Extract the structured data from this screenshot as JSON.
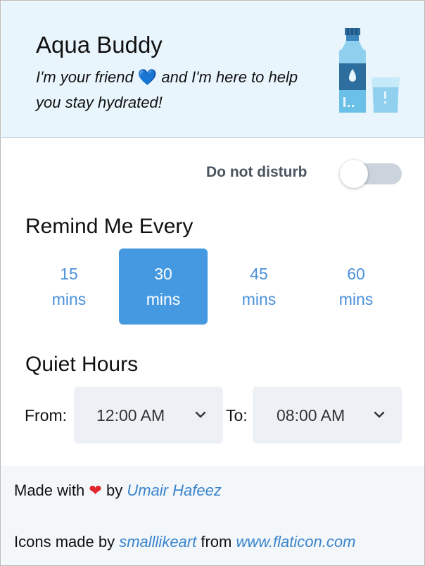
{
  "header": {
    "title": "Aqua Buddy",
    "tagline_before": "I'm your friend",
    "tagline_heart": "💙",
    "tagline_after": "and I'm here to help you stay hydrated!",
    "illustration": "water-bottle-and-glass-icon"
  },
  "dnd": {
    "label": "Do not disturb",
    "enabled": false
  },
  "reminder": {
    "title": "Remind Me Every",
    "options": [
      {
        "value": "15",
        "unit": "mins",
        "selected": false
      },
      {
        "value": "30",
        "unit": "mins",
        "selected": true
      },
      {
        "value": "45",
        "unit": "mins",
        "selected": false
      },
      {
        "value": "60",
        "unit": "mins",
        "selected": false
      }
    ]
  },
  "quiet_hours": {
    "title": "Quiet Hours",
    "from_label": "From:",
    "from_value": "12:00 AM",
    "to_label": "To:",
    "to_value": "08:00 AM"
  },
  "footer": {
    "made_with": "Made with",
    "heart": "❤",
    "by": "by",
    "author": "Umair Hafeez",
    "icons_made_by": "Icons made by",
    "icon_author": "smalllikeart",
    "from": "from",
    "icon_site": "www.flaticon.com"
  },
  "colors": {
    "accent": "#4599e0",
    "link": "#3a84cc",
    "header_bg": "#e9f5fc",
    "toggle_off": "#cbd3dc",
    "heart_red": "#e0282e"
  }
}
